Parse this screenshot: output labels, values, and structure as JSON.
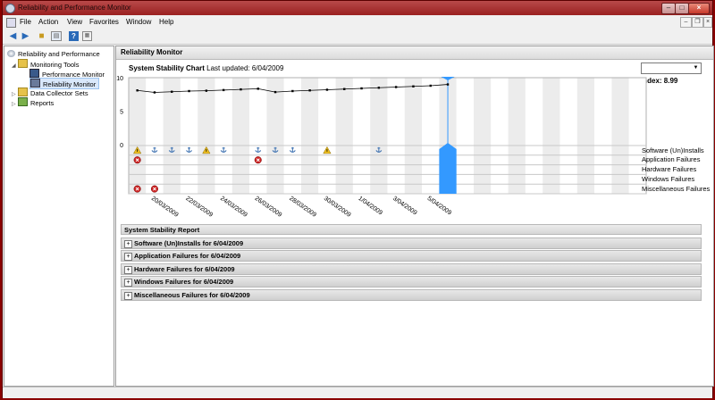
{
  "window": {
    "title": "Reliability and Performance Monitor"
  },
  "menu": [
    "File",
    "Action",
    "View",
    "Favorites",
    "Window",
    "Help"
  ],
  "tree": {
    "root": "Reliability and Performance",
    "monitoring_tools": "Monitoring Tools",
    "performance_monitor": "Performance Monitor",
    "reliability_monitor": "Reliability Monitor",
    "data_collector_sets": "Data Collector Sets",
    "reports": "Reports"
  },
  "panel": {
    "title": "Reliability Monitor"
  },
  "chart": {
    "title": "System Stability Chart",
    "last_updated": "Last updated: 6/04/2009",
    "index_label": "Index: 8.99",
    "selected_date": "",
    "y_ticks": [
      "10",
      "5",
      "0"
    ],
    "row_labels": [
      "Software (Un)Installs",
      "Application Failures",
      "Hardware Failures",
      "Windows Failures",
      "Miscellaneous Failures"
    ],
    "date_labels": [
      "20/03/2009",
      "22/03/2009",
      "24/03/2009",
      "26/03/2009",
      "28/03/2009",
      "30/03/2009",
      "1/04/2009",
      "3/04/2009",
      "5/04/2009"
    ],
    "colors": {
      "selection": "#3399ff",
      "line": "#000000",
      "error": "#cc2222",
      "warning": "#f0c020",
      "info": "#3a6fb0"
    }
  },
  "chart_data": {
    "type": "line",
    "title": "System Stability Chart",
    "ylim": [
      0,
      10
    ],
    "x": [
      "19/03",
      "20/03",
      "21/03",
      "22/03",
      "23/03",
      "24/03",
      "25/03",
      "26/03",
      "27/03",
      "28/03",
      "29/03",
      "30/03",
      "31/03",
      "1/04",
      "2/04",
      "3/04",
      "4/04",
      "5/04",
      "6/04"
    ],
    "values": [
      8.1,
      7.8,
      7.9,
      8.0,
      8.05,
      8.15,
      8.25,
      8.35,
      7.85,
      8.0,
      8.1,
      8.2,
      8.3,
      8.4,
      8.5,
      8.6,
      8.7,
      8.8,
      8.99
    ]
  },
  "events": {
    "software": [
      {
        "col": 0,
        "kind": "warning"
      },
      {
        "col": 1,
        "kind": "info"
      },
      {
        "col": 2,
        "kind": "info"
      },
      {
        "col": 3,
        "kind": "info"
      },
      {
        "col": 4,
        "kind": "warning"
      },
      {
        "col": 5,
        "kind": "info"
      },
      {
        "col": 7,
        "kind": "info"
      },
      {
        "col": 8,
        "kind": "info"
      },
      {
        "col": 9,
        "kind": "info"
      },
      {
        "col": 11,
        "kind": "warning"
      },
      {
        "col": 14,
        "kind": "info"
      }
    ],
    "application": [
      {
        "col": 0,
        "kind": "error"
      },
      {
        "col": 7,
        "kind": "error"
      }
    ],
    "misc": [
      {
        "col": 0,
        "kind": "error"
      },
      {
        "col": 1,
        "kind": "error"
      }
    ]
  },
  "report": {
    "title": "System Stability Report",
    "rows": [
      "Software (Un)Installs for 6/04/2009",
      "Application Failures for 6/04/2009",
      "Hardware Failures for 6/04/2009",
      "Windows Failures for 6/04/2009",
      "Miscellaneous Failures for 6/04/2009"
    ]
  }
}
